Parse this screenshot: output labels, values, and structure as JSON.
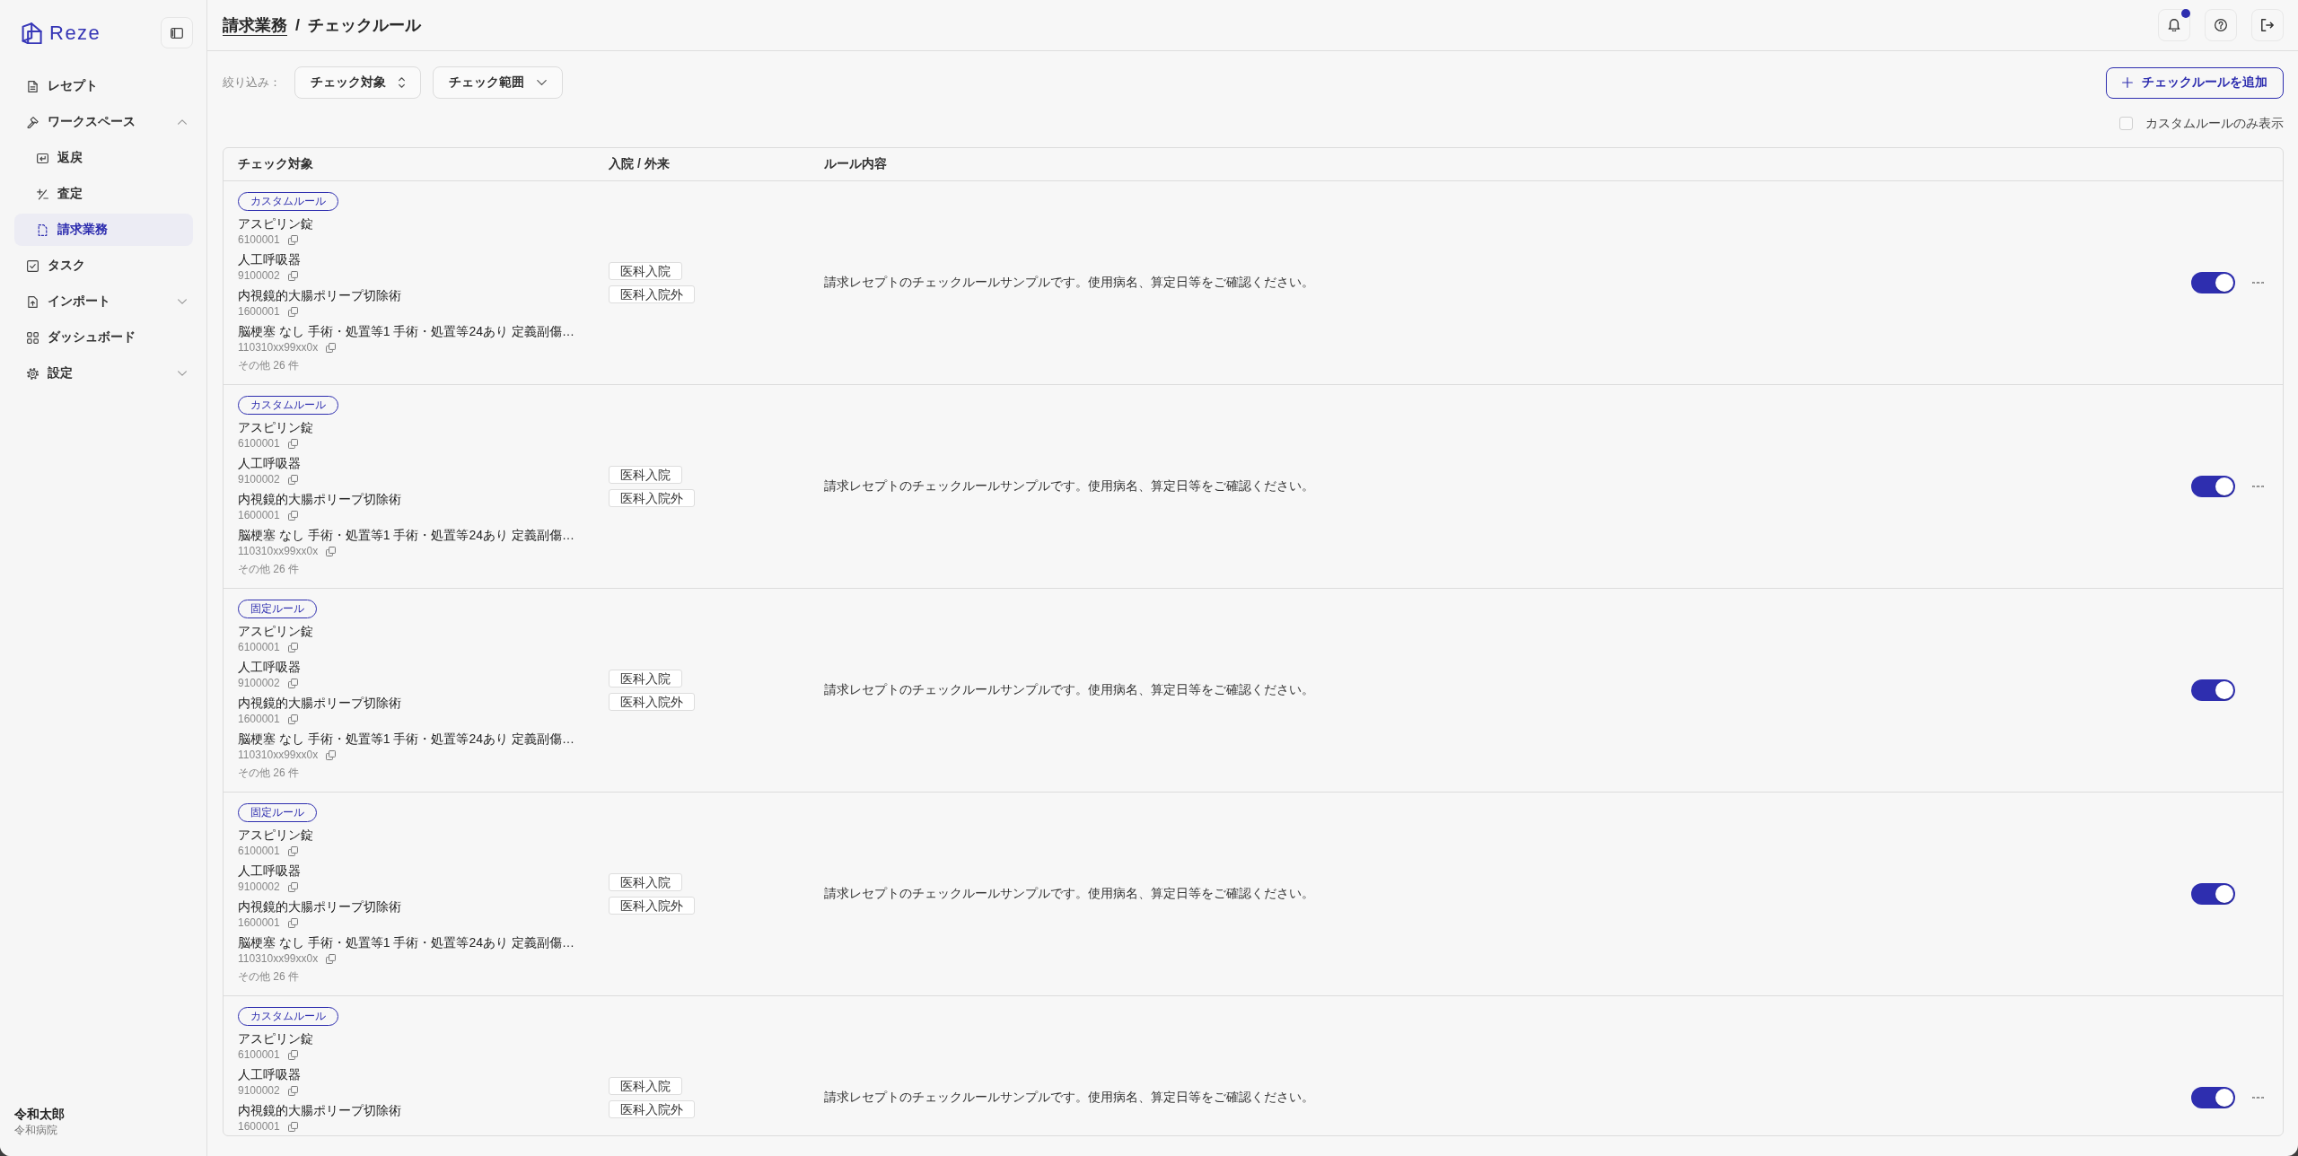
{
  "sidebar": {
    "logo": "Reze",
    "items": [
      {
        "label": "レセプト",
        "selected": false
      },
      {
        "label": "ワークスペース",
        "selected": false,
        "expanded": true,
        "children": [
          {
            "label": "返戻",
            "selected": false
          },
          {
            "label": "査定",
            "selected": false
          },
          {
            "label": "請求業務",
            "selected": true
          }
        ]
      },
      {
        "label": "タスク",
        "selected": false
      },
      {
        "label": "インポート",
        "selected": false,
        "expanded": false
      },
      {
        "label": "ダッシュボード",
        "selected": false
      },
      {
        "label": "設定",
        "selected": false,
        "expanded": false
      }
    ],
    "user": {
      "name": "令和太郎",
      "hospital": "令和病院"
    }
  },
  "header": {
    "breadcrumb": [
      {
        "label": "請求業務",
        "link": true
      },
      {
        "label": "チェックルール",
        "link": false
      }
    ],
    "separator": "/",
    "notification_unread": true
  },
  "toolbar": {
    "filter_label": "絞り込み：",
    "filters": [
      {
        "label": "チェック対象",
        "kind": "sort"
      },
      {
        "label": "チェック範囲",
        "kind": "dropdown"
      }
    ],
    "add_button": "チェックルールを追加",
    "custom_only": {
      "label": "カスタムルールのみ表示",
      "checked": false
    }
  },
  "table": {
    "columns": [
      "チェック対象",
      "入院 / 外来",
      "ルール内容"
    ],
    "rows": [
      {
        "kind": "custom",
        "tag": "カスタムルール",
        "targets": [
          {
            "name": "アスピリン錠",
            "code": "6100001"
          },
          {
            "name": "人工呼吸器",
            "code": "9100002"
          },
          {
            "name": "内視鏡的大腸ポリープ切除術",
            "code": "1600001"
          },
          {
            "name": "脳梗塞 なし 手術・処置等1 手術・処置等24あり 定義副傷…",
            "code": "110310xx99xx0x"
          }
        ],
        "more": "その他 26 件",
        "scopes": [
          "医科入院",
          "医科入院外"
        ],
        "rule": "請求レセプトのチェックルールサンプルです。使用病名、算定日等をご確認ください。",
        "enabled": true
      },
      {
        "kind": "custom",
        "tag": "カスタムルール",
        "targets": [
          {
            "name": "アスピリン錠",
            "code": "6100001"
          },
          {
            "name": "人工呼吸器",
            "code": "9100002"
          },
          {
            "name": "内視鏡的大腸ポリープ切除術",
            "code": "1600001"
          },
          {
            "name": "脳梗塞 なし 手術・処置等1 手術・処置等24あり 定義副傷…",
            "code": "110310xx99xx0x"
          }
        ],
        "more": "その他 26 件",
        "scopes": [
          "医科入院",
          "医科入院外"
        ],
        "rule": "請求レセプトのチェックルールサンプルです。使用病名、算定日等をご確認ください。",
        "enabled": true
      },
      {
        "kind": "fixed",
        "tag": "固定ルール",
        "targets": [
          {
            "name": "アスピリン錠",
            "code": "6100001"
          },
          {
            "name": "人工呼吸器",
            "code": "9100002"
          },
          {
            "name": "内視鏡的大腸ポリープ切除術",
            "code": "1600001"
          },
          {
            "name": "脳梗塞 なし 手術・処置等1 手術・処置等24あり 定義副傷…",
            "code": "110310xx99xx0x"
          }
        ],
        "more": "その他 26 件",
        "scopes": [
          "医科入院",
          "医科入院外"
        ],
        "rule": "請求レセプトのチェックルールサンプルです。使用病名、算定日等をご確認ください。",
        "enabled": true
      },
      {
        "kind": "fixed",
        "tag": "固定ルール",
        "targets": [
          {
            "name": "アスピリン錠",
            "code": "6100001"
          },
          {
            "name": "人工呼吸器",
            "code": "9100002"
          },
          {
            "name": "内視鏡的大腸ポリープ切除術",
            "code": "1600001"
          },
          {
            "name": "脳梗塞 なし 手術・処置等1 手術・処置等24あり 定義副傷…",
            "code": "110310xx99xx0x"
          }
        ],
        "more": "その他 26 件",
        "scopes": [
          "医科入院",
          "医科入院外"
        ],
        "rule": "請求レセプトのチェックルールサンプルです。使用病名、算定日等をご確認ください。",
        "enabled": true
      },
      {
        "kind": "custom",
        "tag": "カスタムルール",
        "targets": [
          {
            "name": "アスピリン錠",
            "code": "6100001"
          },
          {
            "name": "人工呼吸器",
            "code": "9100002"
          },
          {
            "name": "内視鏡的大腸ポリープ切除術",
            "code": "1600001"
          }
        ],
        "scopes": [
          "医科入院",
          "医科入院外"
        ],
        "rule": "請求レセプトのチェックルールサンプルです。使用病名、算定日等をご確認ください。",
        "enabled": true
      }
    ]
  }
}
